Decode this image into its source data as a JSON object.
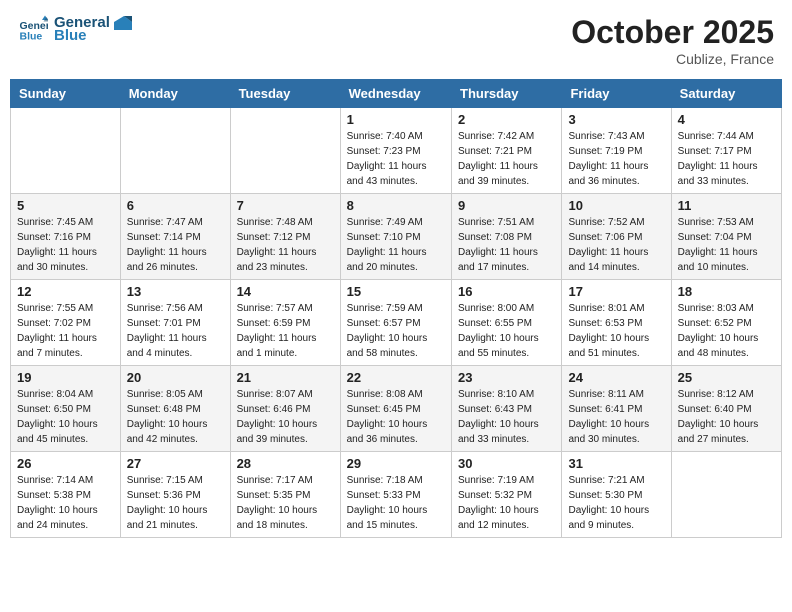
{
  "header": {
    "logo_line1": "General",
    "logo_line2": "Blue",
    "month_title": "October 2025",
    "location": "Cublize, France"
  },
  "days_of_week": [
    "Sunday",
    "Monday",
    "Tuesday",
    "Wednesday",
    "Thursday",
    "Friday",
    "Saturday"
  ],
  "weeks": [
    [
      {
        "day": "",
        "info": ""
      },
      {
        "day": "",
        "info": ""
      },
      {
        "day": "",
        "info": ""
      },
      {
        "day": "1",
        "info": "Sunrise: 7:40 AM\nSunset: 7:23 PM\nDaylight: 11 hours\nand 43 minutes."
      },
      {
        "day": "2",
        "info": "Sunrise: 7:42 AM\nSunset: 7:21 PM\nDaylight: 11 hours\nand 39 minutes."
      },
      {
        "day": "3",
        "info": "Sunrise: 7:43 AM\nSunset: 7:19 PM\nDaylight: 11 hours\nand 36 minutes."
      },
      {
        "day": "4",
        "info": "Sunrise: 7:44 AM\nSunset: 7:17 PM\nDaylight: 11 hours\nand 33 minutes."
      }
    ],
    [
      {
        "day": "5",
        "info": "Sunrise: 7:45 AM\nSunset: 7:16 PM\nDaylight: 11 hours\nand 30 minutes."
      },
      {
        "day": "6",
        "info": "Sunrise: 7:47 AM\nSunset: 7:14 PM\nDaylight: 11 hours\nand 26 minutes."
      },
      {
        "day": "7",
        "info": "Sunrise: 7:48 AM\nSunset: 7:12 PM\nDaylight: 11 hours\nand 23 minutes."
      },
      {
        "day": "8",
        "info": "Sunrise: 7:49 AM\nSunset: 7:10 PM\nDaylight: 11 hours\nand 20 minutes."
      },
      {
        "day": "9",
        "info": "Sunrise: 7:51 AM\nSunset: 7:08 PM\nDaylight: 11 hours\nand 17 minutes."
      },
      {
        "day": "10",
        "info": "Sunrise: 7:52 AM\nSunset: 7:06 PM\nDaylight: 11 hours\nand 14 minutes."
      },
      {
        "day": "11",
        "info": "Sunrise: 7:53 AM\nSunset: 7:04 PM\nDaylight: 11 hours\nand 10 minutes."
      }
    ],
    [
      {
        "day": "12",
        "info": "Sunrise: 7:55 AM\nSunset: 7:02 PM\nDaylight: 11 hours\nand 7 minutes."
      },
      {
        "day": "13",
        "info": "Sunrise: 7:56 AM\nSunset: 7:01 PM\nDaylight: 11 hours\nand 4 minutes."
      },
      {
        "day": "14",
        "info": "Sunrise: 7:57 AM\nSunset: 6:59 PM\nDaylight: 11 hours\nand 1 minute."
      },
      {
        "day": "15",
        "info": "Sunrise: 7:59 AM\nSunset: 6:57 PM\nDaylight: 10 hours\nand 58 minutes."
      },
      {
        "day": "16",
        "info": "Sunrise: 8:00 AM\nSunset: 6:55 PM\nDaylight: 10 hours\nand 55 minutes."
      },
      {
        "day": "17",
        "info": "Sunrise: 8:01 AM\nSunset: 6:53 PM\nDaylight: 10 hours\nand 51 minutes."
      },
      {
        "day": "18",
        "info": "Sunrise: 8:03 AM\nSunset: 6:52 PM\nDaylight: 10 hours\nand 48 minutes."
      }
    ],
    [
      {
        "day": "19",
        "info": "Sunrise: 8:04 AM\nSunset: 6:50 PM\nDaylight: 10 hours\nand 45 minutes."
      },
      {
        "day": "20",
        "info": "Sunrise: 8:05 AM\nSunset: 6:48 PM\nDaylight: 10 hours\nand 42 minutes."
      },
      {
        "day": "21",
        "info": "Sunrise: 8:07 AM\nSunset: 6:46 PM\nDaylight: 10 hours\nand 39 minutes."
      },
      {
        "day": "22",
        "info": "Sunrise: 8:08 AM\nSunset: 6:45 PM\nDaylight: 10 hours\nand 36 minutes."
      },
      {
        "day": "23",
        "info": "Sunrise: 8:10 AM\nSunset: 6:43 PM\nDaylight: 10 hours\nand 33 minutes."
      },
      {
        "day": "24",
        "info": "Sunrise: 8:11 AM\nSunset: 6:41 PM\nDaylight: 10 hours\nand 30 minutes."
      },
      {
        "day": "25",
        "info": "Sunrise: 8:12 AM\nSunset: 6:40 PM\nDaylight: 10 hours\nand 27 minutes."
      }
    ],
    [
      {
        "day": "26",
        "info": "Sunrise: 7:14 AM\nSunset: 5:38 PM\nDaylight: 10 hours\nand 24 minutes."
      },
      {
        "day": "27",
        "info": "Sunrise: 7:15 AM\nSunset: 5:36 PM\nDaylight: 10 hours\nand 21 minutes."
      },
      {
        "day": "28",
        "info": "Sunrise: 7:17 AM\nSunset: 5:35 PM\nDaylight: 10 hours\nand 18 minutes."
      },
      {
        "day": "29",
        "info": "Sunrise: 7:18 AM\nSunset: 5:33 PM\nDaylight: 10 hours\nand 15 minutes."
      },
      {
        "day": "30",
        "info": "Sunrise: 7:19 AM\nSunset: 5:32 PM\nDaylight: 10 hours\nand 12 minutes."
      },
      {
        "day": "31",
        "info": "Sunrise: 7:21 AM\nSunset: 5:30 PM\nDaylight: 10 hours\nand 9 minutes."
      },
      {
        "day": "",
        "info": ""
      }
    ]
  ]
}
